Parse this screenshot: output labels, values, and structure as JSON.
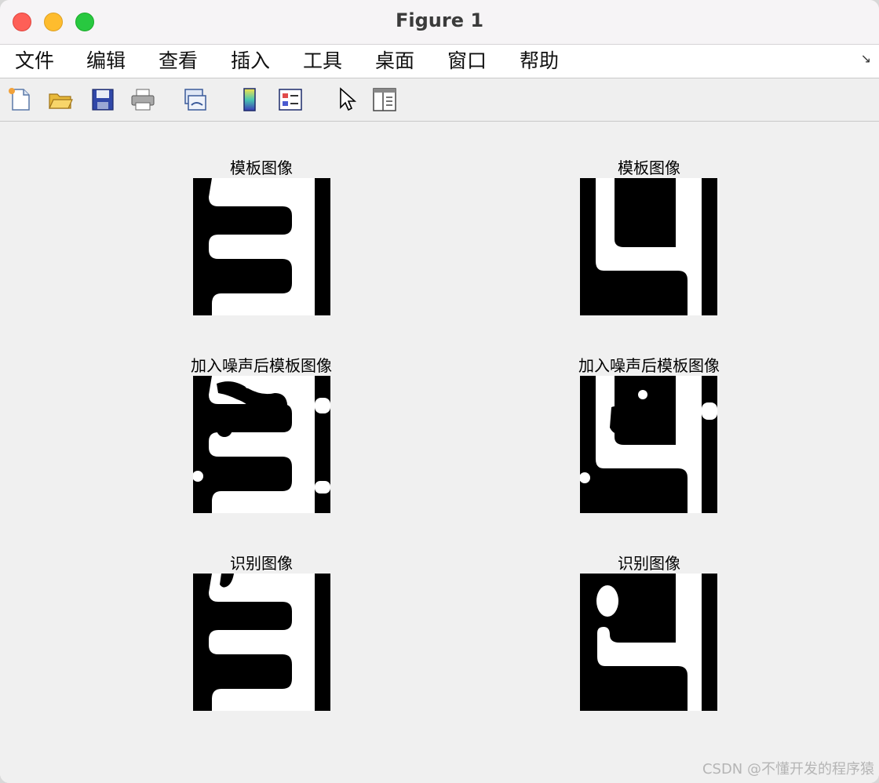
{
  "window": {
    "title": "Figure 1"
  },
  "menu": {
    "items": [
      "文件",
      "编辑",
      "查看",
      "插入",
      "工具",
      "桌面",
      "窗口",
      "帮助"
    ],
    "grip_glyph": "↘"
  },
  "toolbar": {
    "buttons": [
      "new-figure-icon",
      "open-file-icon",
      "save-icon",
      "print-icon",
      "link-plot-icon",
      "colorbar-icon",
      "legend-icon",
      "pointer-icon",
      "property-inspector-icon"
    ]
  },
  "subplots": {
    "template_1": {
      "title": "模板图像"
    },
    "template_2": {
      "title": "模板图像"
    },
    "noisy_1": {
      "title": "加入噪声后模板图像"
    },
    "noisy_2": {
      "title": "加入噪声后模板图像"
    },
    "recog_1": {
      "title": "识别图像"
    },
    "recog_2": {
      "title": "识别图像"
    }
  },
  "watermark": "CSDN @不懂开发的程序猿",
  "colors": {
    "close": "#fe5f57",
    "minimize": "#febc2e",
    "maximize": "#28c840"
  }
}
